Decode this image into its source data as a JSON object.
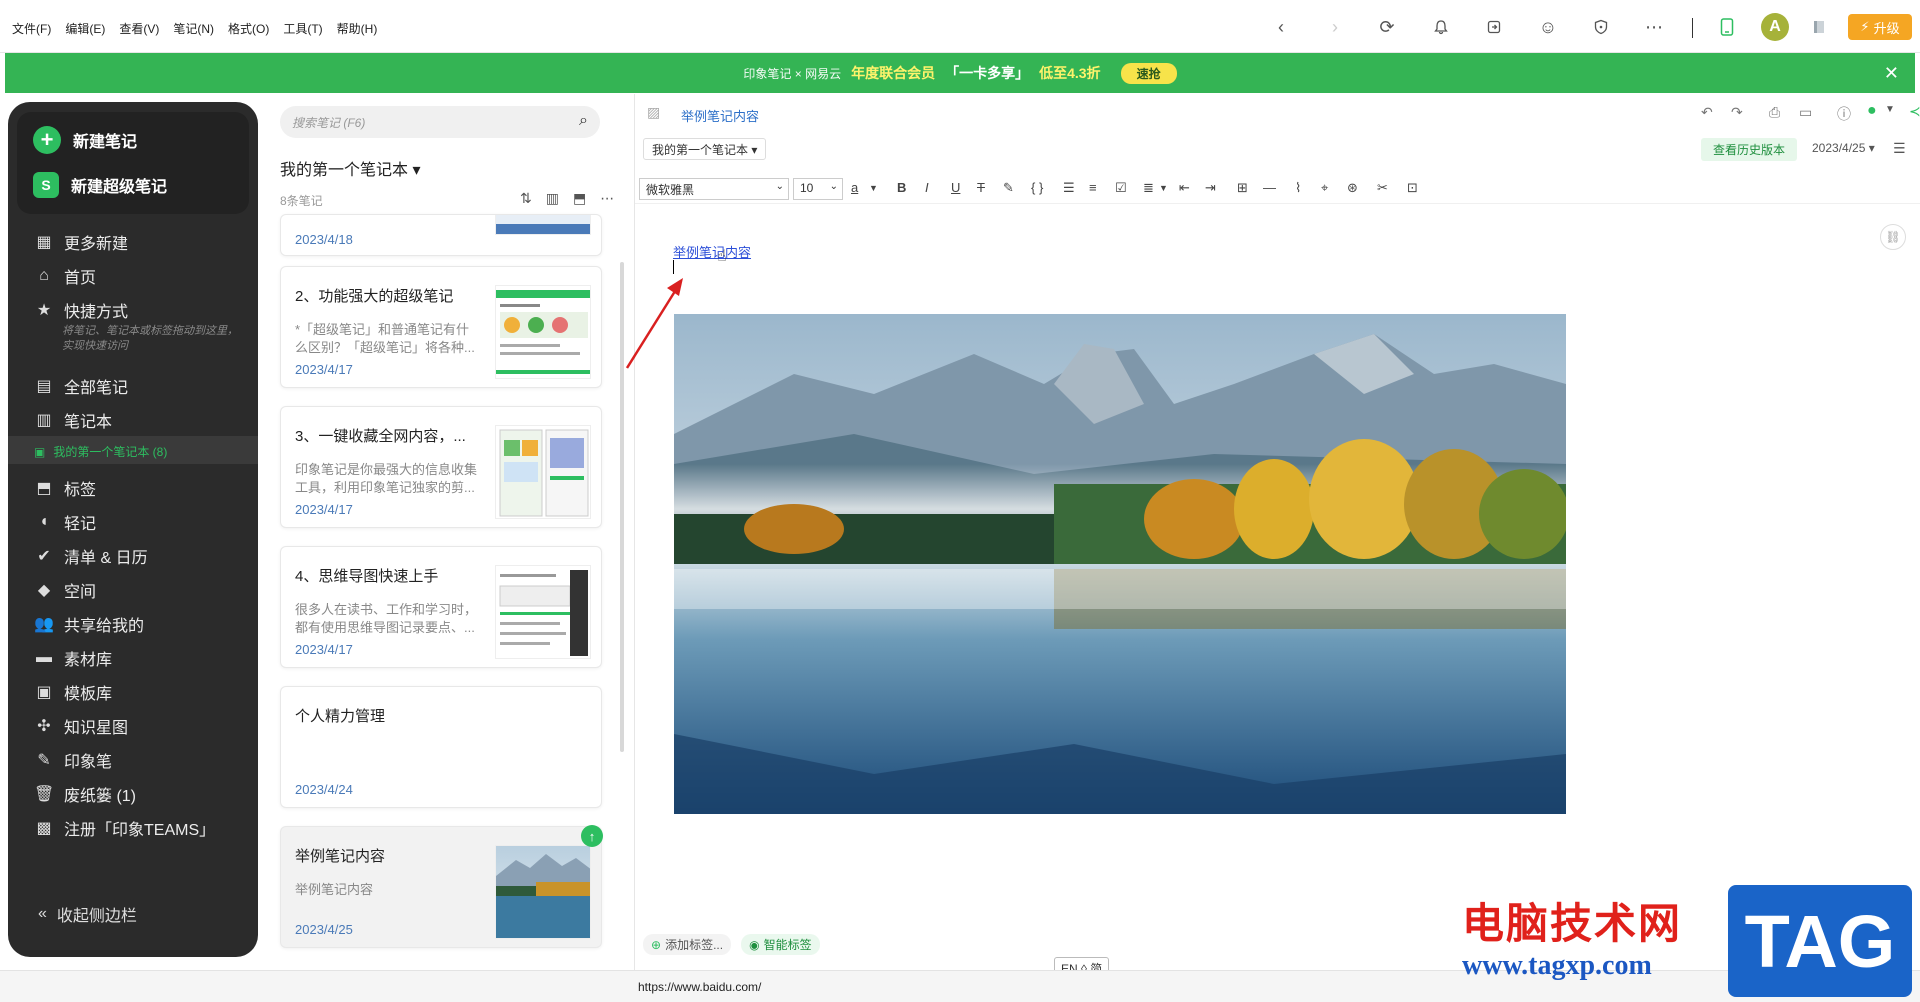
{
  "menu": [
    "文件(F)",
    "编辑(E)",
    "查看(V)",
    "笔记(N)",
    "格式(O)",
    "工具(T)",
    "帮助(H)"
  ],
  "topbar": {
    "upgrade_label": "升级",
    "avatar_letter": "A"
  },
  "promo": {
    "logo_text": "印象笔记 × 网易云",
    "text_a": "年度联合会员",
    "text_b": "「一卡多享」",
    "text_c": "低至4.3折",
    "button": "速抢"
  },
  "sidebar": {
    "new_note": "新建笔记",
    "new_super_note": "新建超级笔记",
    "items": [
      {
        "label": "更多新建",
        "icon": "grid-icon"
      },
      {
        "label": "首页",
        "icon": "home-icon"
      },
      {
        "label": "快捷方式",
        "icon": "star-icon"
      },
      {
        "label": "全部笔记",
        "icon": "note-icon"
      },
      {
        "label": "笔记本",
        "icon": "notebook-icon"
      },
      {
        "label": "标签",
        "icon": "tag-icon"
      },
      {
        "label": "轻记",
        "icon": "quick-note-icon"
      },
      {
        "label": "清单 & 日历",
        "icon": "check-icon"
      },
      {
        "label": "空间",
        "icon": "cube-icon"
      },
      {
        "label": "共享给我的",
        "icon": "people-icon"
      },
      {
        "label": "素材库",
        "icon": "library-icon"
      },
      {
        "label": "模板库",
        "icon": "template-icon"
      },
      {
        "label": "知识星图",
        "icon": "graph-icon"
      },
      {
        "label": "印象笔",
        "icon": "pen-icon"
      },
      {
        "label": "废纸篓 (1)",
        "icon": "trash-icon"
      },
      {
        "label": "注册「印象TEAMS」",
        "icon": "building-icon"
      }
    ],
    "shortcut_hint": "将笔记、笔记本或标签拖动到这里，实现快速访问",
    "active_notebook": "我的第一个笔记本 (8)",
    "collapse_label": "收起侧边栏"
  },
  "notelist": {
    "search_placeholder": "搜索笔记 (F6)",
    "notebook_title": "我的第一个笔记本 ▾",
    "count": "8条笔记",
    "cards": [
      {
        "title": "",
        "snippet": "",
        "date": "2023/4/18"
      },
      {
        "title": "2、功能强大的超级笔记",
        "snippet": "*「超级笔记」和普通笔记有什么区别？「超级笔记」将各种...",
        "date": "2023/4/17"
      },
      {
        "title": "3、一键收藏全网内容，...",
        "snippet": "印象笔记是你最强大的信息收集工具，利用印象笔记独家的剪...",
        "date": "2023/4/17"
      },
      {
        "title": "4、思维导图快速上手",
        "snippet": "很多人在读书、工作和学习时，都有使用思维导图记录要点、...",
        "date": "2023/4/17"
      },
      {
        "title": "个人精力管理",
        "snippet": "",
        "date": "2023/4/24"
      },
      {
        "title": "举例笔记内容",
        "snippet": "举例笔记内容",
        "date": "2023/4/25"
      }
    ]
  },
  "editor": {
    "note_title": "举例笔记内容",
    "notebook_select": "我的第一个笔记本 ▾",
    "history_btn": "查看历史版本",
    "date": "2023/4/25 ▾",
    "font": "微软雅黑",
    "size": "10",
    "link_text": "举例笔记内容",
    "add_tag": "添加标签...",
    "smart_tag": "智能标签",
    "ime": "EN ◊ 简"
  },
  "status": {
    "url": "https://www.baidu.com/"
  },
  "watermark": {
    "cn": "电脑技术网",
    "url": "www.tagxp.com",
    "tag": "TAG"
  },
  "colors": {
    "accent": "#2dbe60",
    "promo": "#34b454",
    "sidebar_bg": "#2b2b2b",
    "link": "#2c4fd8"
  }
}
